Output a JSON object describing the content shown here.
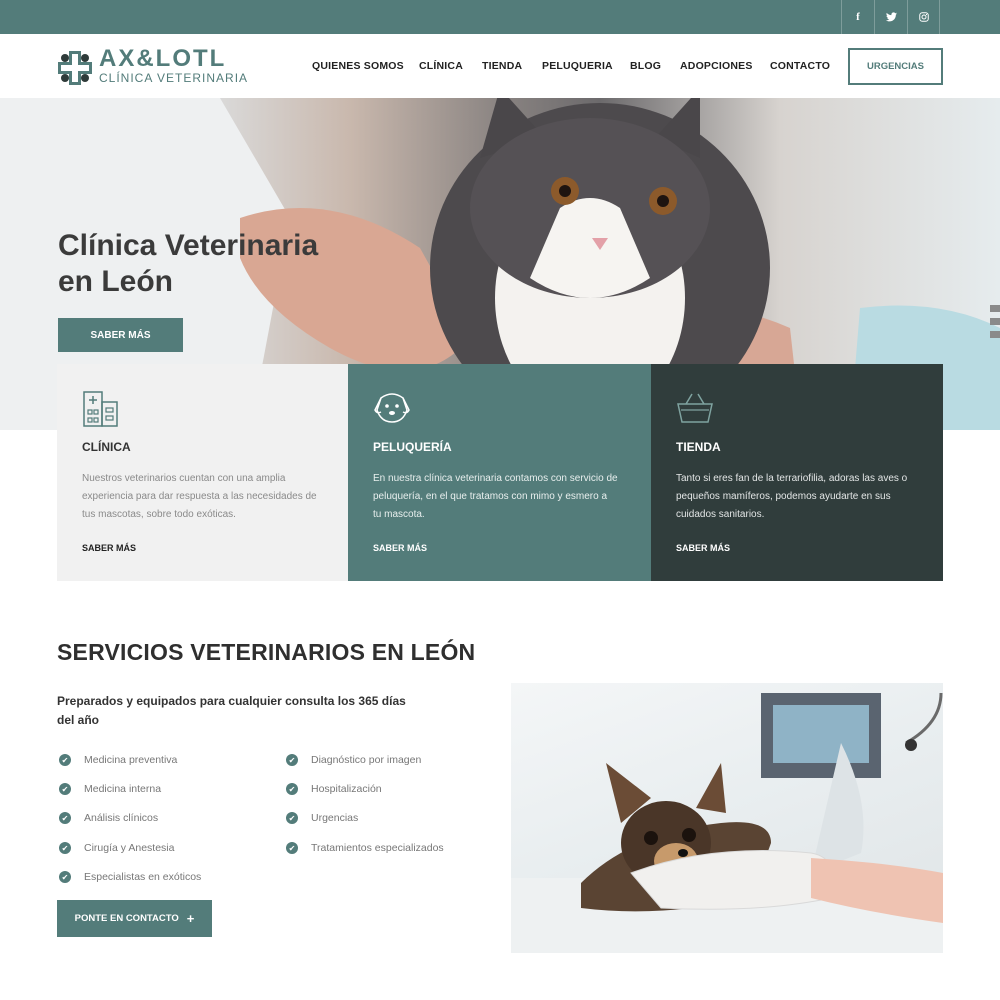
{
  "social": {
    "facebook": "f",
    "twitter": "twitter-icon",
    "instagram": "instagram-icon"
  },
  "brand": {
    "name": "AX&LOTL",
    "subtitle": "CLÍNICA VETERINARIA"
  },
  "nav": {
    "items": [
      "QUIENES SOMOS",
      "CLÍNICA",
      "TIENDA",
      "PELUQUERIA",
      "BLOG",
      "ADOPCIONES",
      "CONTACTO"
    ],
    "cta": "URGENCIAS"
  },
  "hero": {
    "title_line1": "Clínica Veterinaria",
    "title_line2": "en León",
    "button": "SABER MÁS"
  },
  "features": [
    {
      "title": "CLÍNICA",
      "text": "Nuestros veterinarios cuentan con una amplia experiencia para dar respuesta a las necesidades de tus mascotas, sobre todo exóticas.",
      "link": "SABER MÁS",
      "icon": "hospital-icon"
    },
    {
      "title": "PELUQUERÍA",
      "text": "En nuestra clínica veterinaria contamos con servicio de peluquería, en el que tratamos con mimo y esmero a tu mascota.",
      "link": "SABER MÁS",
      "icon": "dog-face-icon"
    },
    {
      "title": "TIENDA",
      "text": "Tanto si eres fan de la terrariofilia, adoras las aves o pequeños mamíferos, podemos ayudarte en sus cuidados sanitarios.",
      "link": "SABER MÁS",
      "icon": "basket-icon"
    }
  ],
  "services": {
    "title": "SERVICIOS VETERINARIOS EN LEÓN",
    "subtitle": "Preparados y equipados para cualquier consulta los 365 días del año",
    "col1": [
      "Medicina preventiva",
      "Medicina interna",
      "Análisis clínicos",
      "Cirugía y Anestesia",
      "Especialistas en exóticos"
    ],
    "col2": [
      "Diagnóstico por imagen",
      "Hospitalización",
      "Urgencias",
      "Tratamientos especializados"
    ],
    "button": "PONTE EN CONTACTO"
  },
  "colors": {
    "accent": "#537c7a",
    "dark": "#303d3c",
    "light_box": "#f1f1f1"
  }
}
